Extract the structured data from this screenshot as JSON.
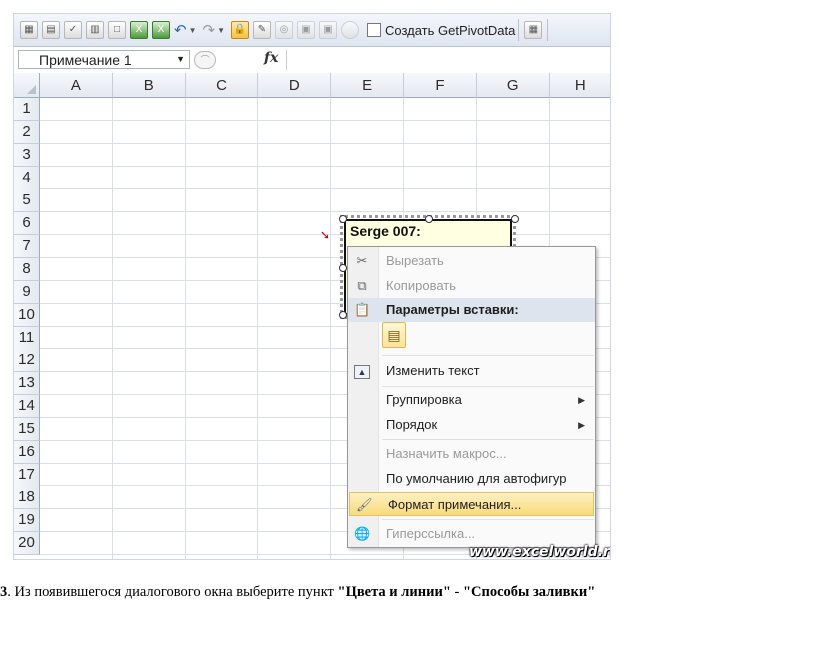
{
  "toolbar": {
    "create_getpivotdata_label": "Создать GetPivotData"
  },
  "formula_bar": {
    "name_box_value": "Примечание 1",
    "fx_label": "fx"
  },
  "columns": [
    "A",
    "B",
    "C",
    "D",
    "E",
    "F",
    "G",
    "H"
  ],
  "rows": [
    "1",
    "2",
    "3",
    "4",
    "5",
    "6",
    "7",
    "8",
    "9",
    "10",
    "11",
    "12",
    "13",
    "14",
    "15",
    "16",
    "17",
    "18",
    "19",
    "20"
  ],
  "comment": {
    "author": "Serge 007:"
  },
  "context_menu": {
    "items": [
      {
        "label": "Вырезать",
        "icon": "scissors-icon",
        "disabled": true
      },
      {
        "label": "Копировать",
        "icon": "copy-icon",
        "disabled": true
      },
      {
        "label": "Параметры вставки:",
        "icon": "paste-icon",
        "header": true
      },
      {
        "label": "Изменить текст",
        "icon": "edit-text-icon"
      },
      {
        "label": "Группировка",
        "submenu": true
      },
      {
        "label": "Порядок",
        "submenu": true
      },
      {
        "label": "Назначить макрос...",
        "disabled": true
      },
      {
        "label": "По умолчанию для автофигур"
      },
      {
        "label": "Формат примечания...",
        "icon": "format-comment-icon",
        "highlighted": true
      },
      {
        "label": "Гиперссылка...",
        "icon": "hyperlink-icon",
        "disabled": true
      }
    ]
  },
  "watermark": "www.excelworld.ru",
  "caption": {
    "step": "3",
    "text_before": ". Из появившегося диалогового окна выберите пункт ",
    "item1": "\"Цвета и линии\"",
    "sep": " - ",
    "item2": "\"Способы заливки\""
  }
}
